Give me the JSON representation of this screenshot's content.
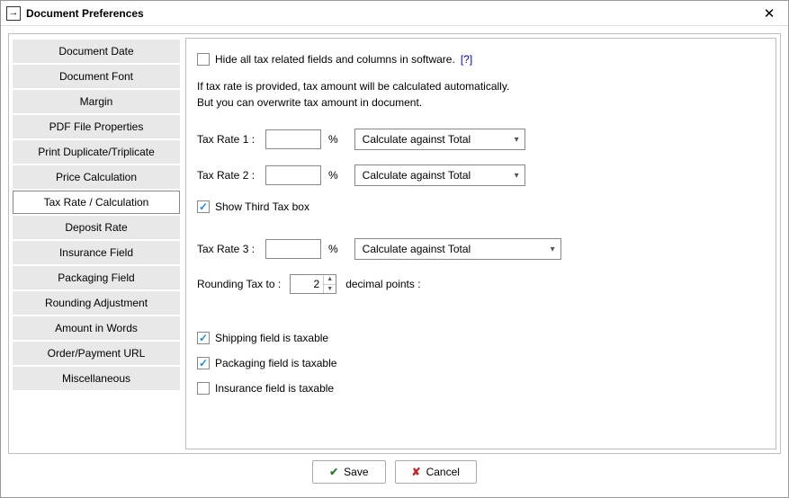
{
  "window": {
    "title": "Document Preferences"
  },
  "sidebar": {
    "items": [
      {
        "label": "Document Date"
      },
      {
        "label": "Document Font"
      },
      {
        "label": "Margin"
      },
      {
        "label": "PDF File Properties"
      },
      {
        "label": "Print Duplicate/Triplicate"
      },
      {
        "label": "Price Calculation"
      },
      {
        "label": "Tax Rate / Calculation",
        "selected": true
      },
      {
        "label": "Deposit Rate"
      },
      {
        "label": "Insurance Field"
      },
      {
        "label": "Packaging Field"
      },
      {
        "label": "Rounding Adjustment"
      },
      {
        "label": "Amount in Words"
      },
      {
        "label": "Order/Payment URL"
      },
      {
        "label": "Miscellaneous"
      }
    ]
  },
  "content": {
    "hide_tax_label": "Hide all tax related fields and columns in software.",
    "hide_tax_checked": false,
    "help_link": "[?]",
    "info_line1": "If tax rate is provided, tax amount will be calculated automatically.",
    "info_line2": "But you can overwrite tax amount in document.",
    "tax_rate_1_label": "Tax Rate 1 :",
    "tax_rate_1_value": "",
    "tax_rate_1_calc": "Calculate against Total",
    "tax_rate_2_label": "Tax Rate 2 :",
    "tax_rate_2_value": "",
    "tax_rate_2_calc": "Calculate against Total",
    "show_third_tax_label": "Show Third Tax box",
    "show_third_tax_checked": true,
    "tax_rate_3_label": "Tax Rate 3 :",
    "tax_rate_3_value": "",
    "tax_rate_3_calc": "Calculate against Total",
    "percent": "%",
    "rounding_label_pre": "Rounding Tax to  :",
    "rounding_value": "2",
    "rounding_label_post": "decimal points :",
    "shipping_taxable_label": "Shipping field is taxable",
    "shipping_taxable_checked": true,
    "packaging_taxable_label": "Packaging field is taxable",
    "packaging_taxable_checked": true,
    "insurance_taxable_label": "Insurance field is taxable",
    "insurance_taxable_checked": false
  },
  "footer": {
    "save": "Save",
    "cancel": "Cancel"
  }
}
